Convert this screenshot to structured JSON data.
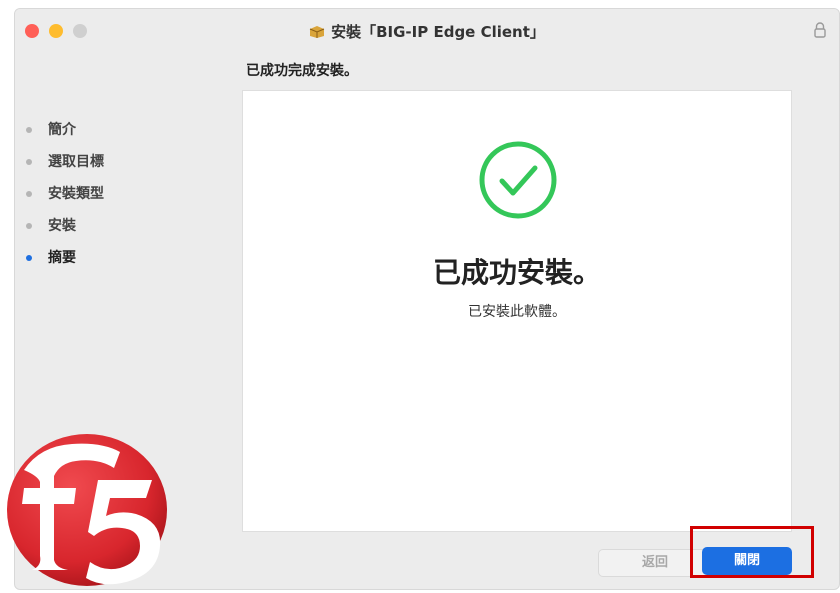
{
  "window": {
    "title": "安裝「BIG-IP Edge Client」",
    "title_icon": "package-icon",
    "lock_icon": "lock-icon"
  },
  "heading": "已成功完成安裝。",
  "sidebar": {
    "steps": [
      {
        "label": "簡介",
        "active": false
      },
      {
        "label": "選取目標",
        "active": false
      },
      {
        "label": "安裝類型",
        "active": false
      },
      {
        "label": "安裝",
        "active": false
      },
      {
        "label": "摘要",
        "active": true
      }
    ]
  },
  "content": {
    "status_icon": "checkmark-circle-icon",
    "success_title": "已成功安裝。",
    "success_subtitle": "已安裝此軟體。"
  },
  "buttons": {
    "back_label": "返回",
    "close_label": "關閉"
  },
  "logo": {
    "text": "f5",
    "icon": "f5-logo"
  },
  "colors": {
    "accent": "#1c6fe2",
    "success": "#34c759",
    "highlight": "#d10000",
    "logo_red": "#d8262d"
  }
}
